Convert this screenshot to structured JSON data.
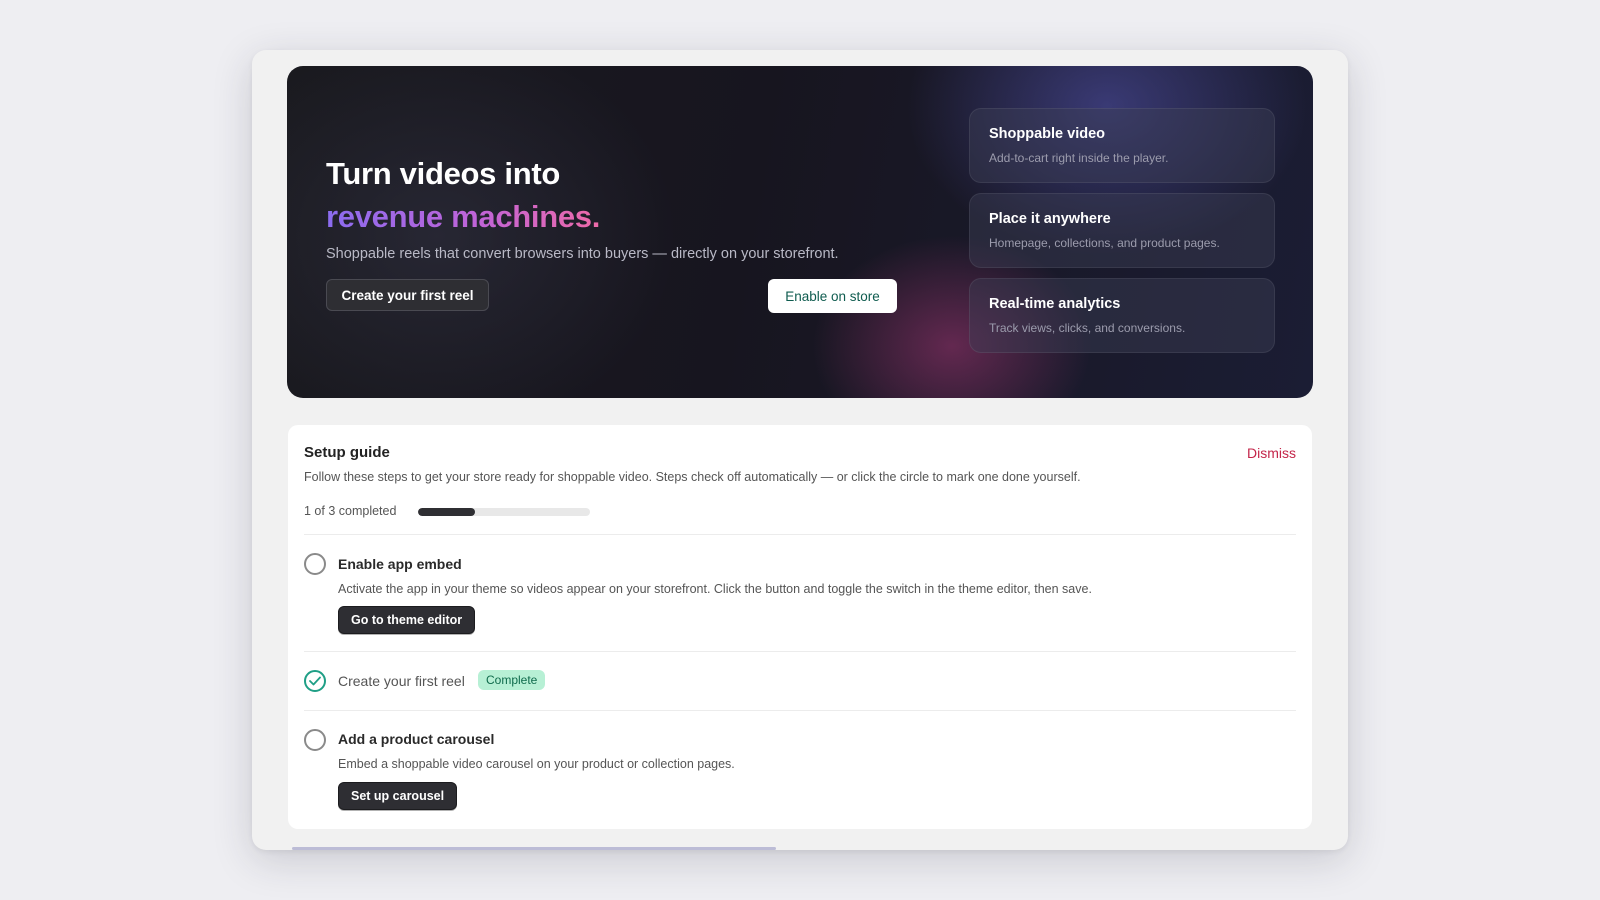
{
  "hero": {
    "title_line1": "Turn videos into",
    "title_line2": "revenue machines.",
    "subtitle": "Shoppable reels that convert browsers into buyers — directly on your storefront.",
    "primary_button": "Create your first reel",
    "secondary_button": "Enable on store",
    "features": [
      {
        "title": "Shoppable video",
        "desc": "Add-to-cart right inside the player."
      },
      {
        "title": "Place it anywhere",
        "desc": "Homepage, collections, and product pages."
      },
      {
        "title": "Real-time analytics",
        "desc": "Track views, clicks, and conversions."
      }
    ]
  },
  "setup": {
    "title": "Setup guide",
    "dismiss": "Dismiss",
    "description": "Follow these steps to get your store ready for shoppable video. Steps check off automatically — or click the circle to mark one done yourself.",
    "progress_text": "1 of 3 completed",
    "progress_fraction": 0.333,
    "steps": [
      {
        "title": "Enable app embed",
        "desc": "Activate the app in your theme so videos appear on your storefront. Click the button and toggle the switch in the theme editor, then save.",
        "button": "Go to theme editor",
        "completed": false
      },
      {
        "title": "Create your first reel",
        "badge": "Complete",
        "completed": true
      },
      {
        "title": "Add a product carousel",
        "desc": "Embed a shoppable video carousel on your product or collection pages.",
        "button": "Set up carousel",
        "completed": false
      }
    ]
  },
  "colors": {
    "accent_dismiss": "#c4264a",
    "complete_badge_bg": "#b7f0d5",
    "complete_check": "#1f9f86"
  }
}
